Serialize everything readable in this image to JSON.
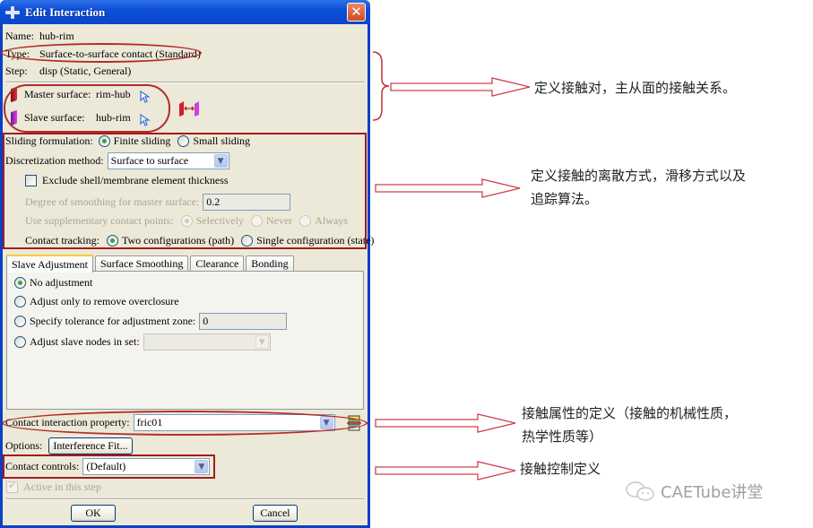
{
  "window": {
    "title": "Edit Interaction",
    "close_label": "✕"
  },
  "info": {
    "name_label": "Name:",
    "name_value": "hub-rim",
    "type_label": "Type:",
    "type_value": "Surface-to-surface contact (Standard)",
    "step_label": "Step:",
    "step_value": "disp (Static, General)"
  },
  "surfaces": {
    "master_label": "Master surface:",
    "master_value": "rim-hub",
    "master_color": "#c0232b",
    "slave_label": "Slave surface:",
    "slave_value": "hub-rim",
    "slave_color": "#c040c8"
  },
  "formulation": {
    "sliding_label": "Sliding formulation:",
    "sliding_options": [
      "Finite sliding",
      "Small sliding"
    ],
    "sliding_selected": "Finite sliding",
    "discretization_label": "Discretization method:",
    "discretization_value": "Surface to surface",
    "exclude_thickness_label": "Exclude shell/membrane element thickness",
    "exclude_thickness_checked": false,
    "smoothing_label": "Degree of smoothing for master surface:",
    "smoothing_value": "0.2",
    "supplementary_label": "Use supplementary contact points:",
    "supplementary_options": [
      "Selectively",
      "Never",
      "Always"
    ],
    "supplementary_selected": "Selectively",
    "tracking_label": "Contact tracking:",
    "tracking_options": [
      "Two configurations (path)",
      "Single configuration (state)"
    ],
    "tracking_selected": "Two configurations (path)"
  },
  "tabs": [
    {
      "label": "Slave Adjustment",
      "active": true
    },
    {
      "label": "Surface Smoothing",
      "active": false
    },
    {
      "label": "Clearance",
      "active": false
    },
    {
      "label": "Bonding",
      "active": false
    }
  ],
  "slave_adjustment": {
    "options": [
      "No adjustment",
      "Adjust only to remove overclosure",
      "Specify tolerance for adjustment zone:",
      "Adjust slave nodes in set:"
    ],
    "selected": "No adjustment",
    "tolerance_value": "0",
    "node_set_value": ""
  },
  "property": {
    "label": "Contact interaction property:",
    "value": "fric01"
  },
  "options": {
    "label": "Options:",
    "interference_button": "Interference Fit..."
  },
  "controls": {
    "label": "Contact controls:",
    "value": "(Default)"
  },
  "active": {
    "label": "Active in this step",
    "checked": true
  },
  "buttons": {
    "ok": "OK",
    "cancel": "Cancel"
  },
  "annotations": {
    "note1": "定义接触对，主从面的接触关系。",
    "note2_line1": "定义接触的离散方式，滑移方式以及",
    "note2_line2": "追踪算法。",
    "note3_line1": "接触属性的定义（接触的机械性质，",
    "note3_line2": "热学性质等）",
    "note4": "接触控制定义",
    "watermark": "CAETube讲堂",
    "highlight_color": "#b22c2c"
  }
}
